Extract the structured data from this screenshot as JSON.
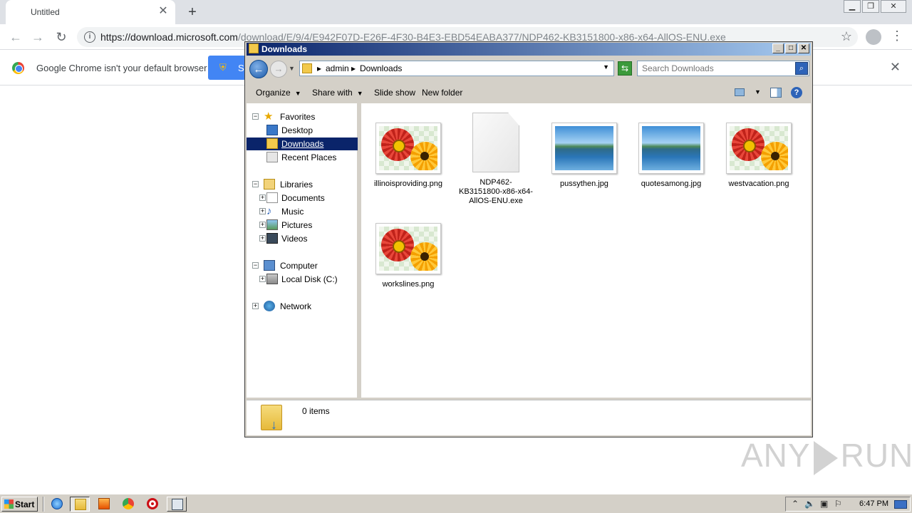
{
  "chrome": {
    "tab_title": "Untitled",
    "tab_close": "✕",
    "new_tab": "+",
    "url_host": "https://download.microsoft.com",
    "url_rest": "/download/E/9/4/E942F07D-E26F-4F30-B4E3-EBD54EABA377/NDP462-KB3151800-x86-x64-AllOS-ENU.exe",
    "infobar_message": "Google Chrome isn't your default browser",
    "infobar_button": "S",
    "infobar_close": "✕"
  },
  "explorer": {
    "title": "Downloads",
    "breadcrumb": [
      "admin",
      "Downloads"
    ],
    "search_placeholder": "Search Downloads",
    "commands": [
      {
        "label": "Organize",
        "dropdown": true
      },
      {
        "label": "Share with",
        "dropdown": true
      },
      {
        "label": "Slide show",
        "dropdown": false
      },
      {
        "label": "New folder",
        "dropdown": false
      }
    ],
    "tree": {
      "favorites": "Favorites",
      "desktop": "Desktop",
      "downloads": "Downloads",
      "recent": "Recent Places",
      "libraries": "Libraries",
      "documents": "Documents",
      "music": "Music",
      "pictures": "Pictures",
      "videos": "Videos",
      "computer": "Computer",
      "local_disk": "Local Disk (C:)",
      "network": "Network"
    },
    "files": [
      {
        "name": "illinoisproviding.png",
        "kind": "flower"
      },
      {
        "name": "NDP462-KB3151800-x86-x64-AllOS-ENU.exe",
        "kind": "exe"
      },
      {
        "name": "pussythen.jpg",
        "kind": "lake"
      },
      {
        "name": "quotesamong.jpg",
        "kind": "lake"
      },
      {
        "name": "westvacation.png",
        "kind": "flower"
      },
      {
        "name": "workslines.png",
        "kind": "flower"
      }
    ],
    "status": "0 items"
  },
  "watermark": {
    "left": "ANY",
    "right": "RUN"
  },
  "taskbar": {
    "start": "Start",
    "clock": "6:47 PM",
    "apps": [
      "internet-explorer-icon",
      "windows-explorer-icon",
      "media-player-icon",
      "chrome-icon",
      "opera-icon",
      "task-manager-icon"
    ]
  }
}
